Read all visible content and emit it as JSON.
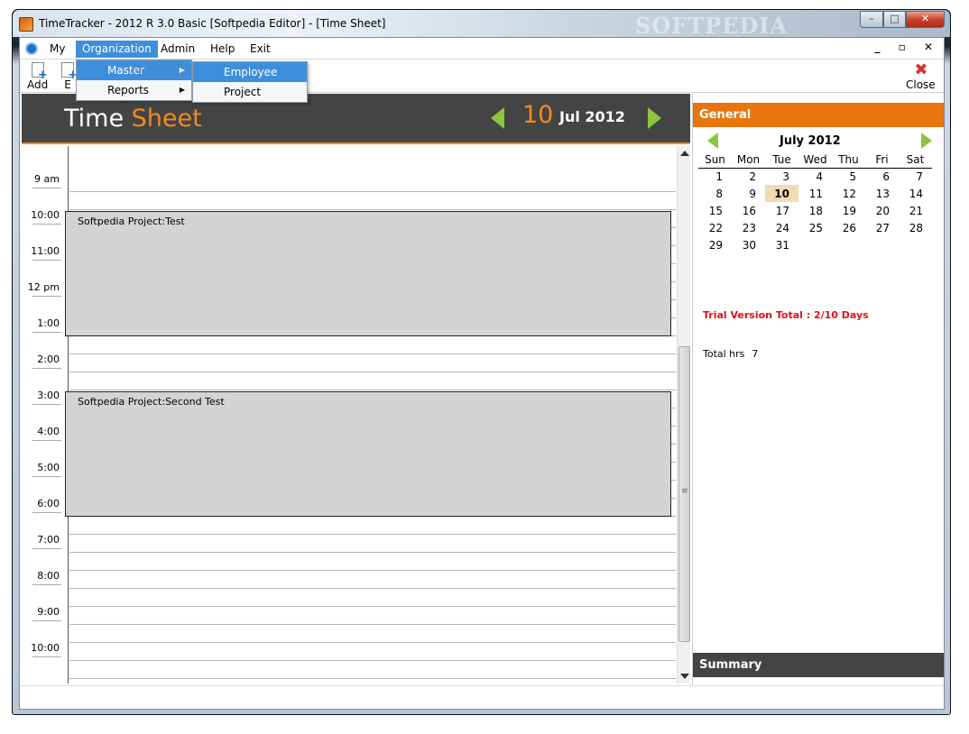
{
  "window": {
    "title": "TimeTracker - 2012 R 3.0 Basic [Softpedia Editor] - [Time Sheet]",
    "watermark": "SOFTPEDIA",
    "minimize": "–",
    "maximize": "□",
    "close": "✕"
  },
  "menubar": {
    "items": [
      "My",
      "Organization",
      "Admin",
      "Help",
      "Exit"
    ],
    "active": "Organization",
    "mdi_controls": "_ ▫ ✕"
  },
  "toolbar": {
    "add_label": "Add",
    "edit_label": "E",
    "close_label": "Close",
    "close_glyph": "✖"
  },
  "organization_menu": {
    "items": [
      {
        "label": "Master",
        "has_submenu": true
      },
      {
        "label": "Reports",
        "has_submenu": true
      }
    ],
    "watermark": "SOFTPEDIA",
    "arrow": "▶"
  },
  "master_submenu": {
    "items": [
      "Employee",
      "Project"
    ]
  },
  "header": {
    "title_part1": "Time",
    "title_part2": "Sheet",
    "day": "10",
    "month_year": "Jul 2012",
    "accent_color": "#f28a1d",
    "nav_color": "#8cc63e"
  },
  "schedule": {
    "time_labels": [
      "9 am",
      "10:00",
      "11:00",
      "12 pm",
      "1:00",
      "2:00",
      "3:00",
      "4:00",
      "5:00",
      "6:00",
      "7:00",
      "8:00",
      "9:00",
      "10:00"
    ],
    "events": [
      {
        "title": "Softpedia Project:Test"
      },
      {
        "title": "Softpedia Project:Second Test"
      }
    ],
    "scroll_grip": "≡"
  },
  "general": {
    "header": "General",
    "calendar": {
      "title": "July 2012",
      "weekdays": [
        "Sun",
        "Mon",
        "Tue",
        "Wed",
        "Thu",
        "Fri",
        "Sat"
      ],
      "weeks": [
        [
          "1",
          "2",
          "3",
          "4",
          "5",
          "6",
          "7"
        ],
        [
          "8",
          "9",
          "10",
          "11",
          "12",
          "13",
          "14"
        ],
        [
          "15",
          "16",
          "17",
          "18",
          "19",
          "20",
          "21"
        ],
        [
          "22",
          "23",
          "24",
          "25",
          "26",
          "27",
          "28"
        ],
        [
          "29",
          "30",
          "31",
          "",
          "",
          "",
          ""
        ]
      ],
      "selected": "10"
    },
    "trial_text": "Trial Version Total : 2/10 Days",
    "trial_color": "#e0111a",
    "hours_label": "Total hrs",
    "hours_value": "7"
  },
  "summary": {
    "header": "Summary"
  },
  "colors": {
    "orange": "#e8760e",
    "dark": "#444444",
    "menu_highlight": "#3d8fdb"
  }
}
